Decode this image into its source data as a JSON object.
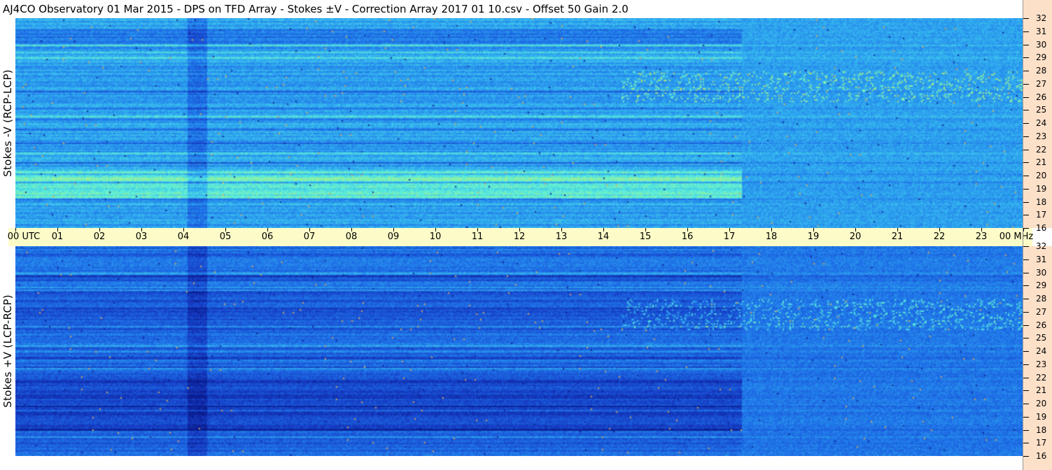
{
  "title": "AJ4CO Observatory  01 Mar 2015  -  DPS on TFD Array  -  Stokes ±V  -  Correction Array 2017 01 10.csv  -  Offset 50  Gain 2.0",
  "chart_data": [
    {
      "type": "heatmap",
      "panel": "top",
      "ylabel": "Stokes -V (RCP-LCP)",
      "x_ticks": [
        "00 UTC",
        "01",
        "02",
        "03",
        "04",
        "05",
        "06",
        "07",
        "08",
        "09",
        "10",
        "11",
        "12",
        "13",
        "14",
        "15",
        "16",
        "17",
        "18",
        "19",
        "20",
        "21",
        "22",
        "23",
        "00 MHz"
      ],
      "x_range_hours": [
        0,
        24
      ],
      "y_ticks": [
        "16",
        "17",
        "18",
        "19",
        "20",
        "21",
        "22",
        "23",
        "24",
        "25",
        "26",
        "27",
        "28",
        "29",
        "30",
        "31",
        "32"
      ],
      "y_range_mhz": [
        16,
        32
      ],
      "colormap": [
        "#0a1a8c",
        "#1640c8",
        "#1f73e8",
        "#33b4f0",
        "#5ef0d8",
        "#c8f060",
        "#ff4040"
      ],
      "base_level": 0.45
    },
    {
      "type": "heatmap",
      "panel": "bottom",
      "ylabel": "Stokes +V (LCP-RCP)",
      "x_ticks": [
        "00 UTC",
        "01",
        "02",
        "03",
        "04",
        "05",
        "06",
        "07",
        "08",
        "09",
        "10",
        "11",
        "12",
        "13",
        "14",
        "15",
        "16",
        "17",
        "18",
        "19",
        "20",
        "21",
        "22",
        "23",
        "00 MHz"
      ],
      "x_range_hours": [
        0,
        24
      ],
      "y_ticks": [
        "16",
        "17",
        "18",
        "19",
        "20",
        "21",
        "22",
        "23",
        "24",
        "25",
        "26",
        "27",
        "28",
        "29",
        "30",
        "31",
        "32"
      ],
      "y_range_mhz": [
        16,
        32
      ],
      "colormap": [
        "#0a1a8c",
        "#1640c8",
        "#1f73e8",
        "#33b4f0",
        "#5ef0d8",
        "#c8f060",
        "#ff4040"
      ],
      "base_level": 0.3
    }
  ]
}
